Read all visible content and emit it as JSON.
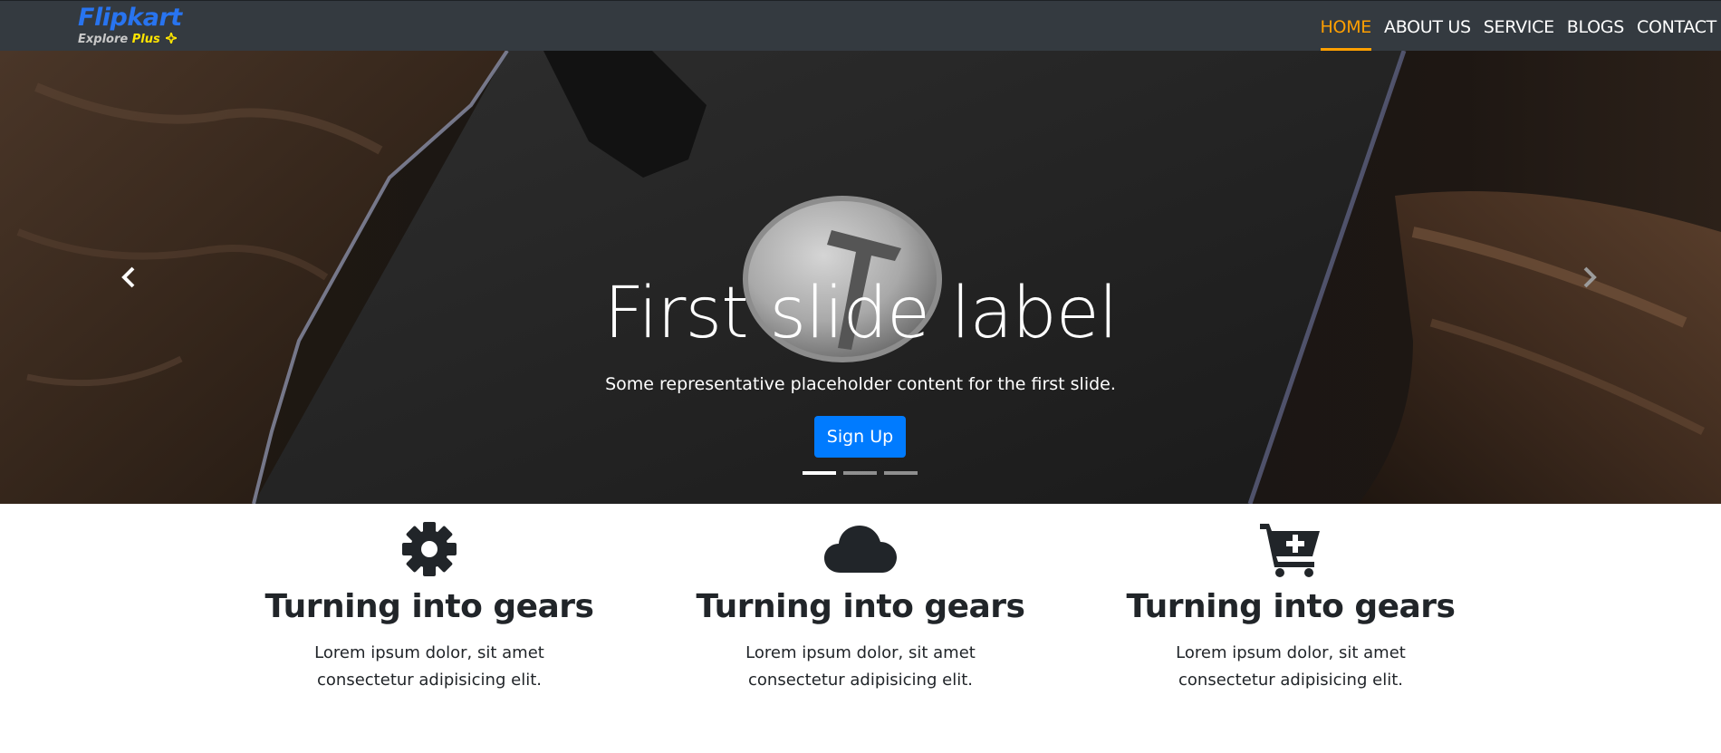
{
  "brand": {
    "name": "Flipkart",
    "sub_explore": "Explore",
    "sub_plus": "Plus",
    "color": "#2874f0",
    "plus_color": "#ffe500"
  },
  "nav": {
    "items": [
      {
        "label": "HOME",
        "active": true
      },
      {
        "label": "ABOUT US",
        "active": false
      },
      {
        "label": "SERVICE",
        "active": false
      },
      {
        "label": "BLOGS",
        "active": false
      },
      {
        "label": "CONTACT",
        "active": false
      }
    ],
    "active_color": "#ff9f00",
    "background": "#343a40"
  },
  "carousel": {
    "title": "First slide label",
    "text": "Some representative placeholder content for the first slide.",
    "button_label": "Sign Up",
    "button_color": "#007bff",
    "slide_count": 3,
    "active_slide": 1,
    "prev_icon": "chevron-left-icon",
    "next_icon": "chevron-right-icon",
    "image_description_icon": "hammer-badge"
  },
  "features": [
    {
      "icon": "gear-icon",
      "title": "Turning into gears",
      "text": "Lorem ipsum dolor, sit amet consectetur adipisicing elit."
    },
    {
      "icon": "cloud-icon",
      "title": "Turning into gears",
      "text": "Lorem ipsum dolor, sit amet consectetur adipisicing elit."
    },
    {
      "icon": "cart-plus-icon",
      "title": "Turning into gears",
      "text": "Lorem ipsum dolor, sit amet consectetur adipisicing elit."
    }
  ]
}
